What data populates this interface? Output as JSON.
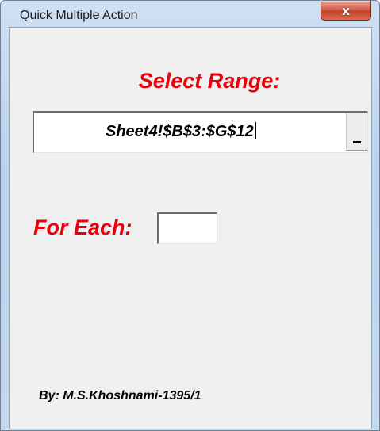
{
  "window": {
    "title": "Quick Multiple Action",
    "close_glyph": "x",
    "close_icon": "close-icon",
    "close_color": "#c3412a"
  },
  "form": {
    "select_range_label": "Select Range:",
    "range_value": "Sheet4!$B$3:$G$12",
    "range_button_icon": "collapse-dialog-icon",
    "for_each_label": "For Each:",
    "for_each_value": "",
    "credit": "By: M.S.Khoshnami-1395/1",
    "label_color": "#e8000c"
  }
}
